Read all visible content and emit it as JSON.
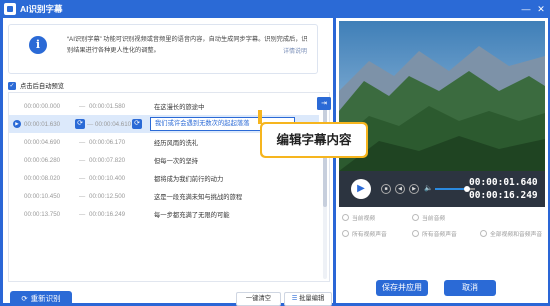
{
  "window": {
    "title": "AI识别字幕",
    "min_label": "—",
    "close_label": "✕"
  },
  "info": {
    "icon_glyph": "i",
    "text": "“AI识别字幕” 功能可识别视频或音频里的语音内容，自动生成同步字幕。识别完成后，识别结果进行各种更人性化的调整。",
    "link": "详情说明"
  },
  "autoplay": {
    "label": "点击后自动预览",
    "checked": true,
    "check_glyph": "✓"
  },
  "subtitles": [
    {
      "start": "00:00:00.000",
      "end": "00:00:01.580",
      "text": "在这漫长的旅途中",
      "active": false
    },
    {
      "start": "00:00:01.630",
      "end": "00:00:04.610",
      "text": "我们或许会遇到无数次的起起落落",
      "active": true
    },
    {
      "start": "00:00:04.690",
      "end": "00:00:06.170",
      "text": "经历风雨的洗礼",
      "active": false
    },
    {
      "start": "00:00:06.280",
      "end": "00:00:07.820",
      "text": "但每一次的坚持",
      "active": false
    },
    {
      "start": "00:00:08.020",
      "end": "00:00:10.400",
      "text": "都将成为我们前行的动力",
      "active": false
    },
    {
      "start": "00:00:10.450",
      "end": "00:00:12.500",
      "text": "这是一段充满未知与挑战的旅程",
      "active": false
    },
    {
      "start": "00:00:13.750",
      "end": "00:00:16.249",
      "text": "每一步都充满了无限的可能",
      "active": false
    }
  ],
  "dash": "—",
  "row_tools": [
    "⇥",
    "⇤",
    "⇆",
    "⧉",
    "🗑"
  ],
  "callout": {
    "text": "编辑字幕内容"
  },
  "bottom": {
    "reidentify": "重新识别",
    "clear": "一键清空",
    "batch": "批量编辑"
  },
  "player": {
    "play_glyph": "▶",
    "stop_glyph": "■",
    "prev_glyph": "◀",
    "next_glyph": "▶",
    "volume_glyph": "🔈",
    "volume_level": 0.8,
    "current_time": "00:00:01.640",
    "total_time": "00:00:16.249"
  },
  "radios": {
    "current_video": "当前视频",
    "current_audio": "当前音频",
    "all_video_audio": "所有视频声音",
    "all_audio_audio": "所有音频声音",
    "all_video_and_audio": "全部视频和音频声音"
  },
  "actions": {
    "apply": "保存并应用",
    "cancel": "取消"
  },
  "colors": {
    "accent": "#2b6ad6",
    "callout": "#f6b51e",
    "player_bg": "#2c3440"
  }
}
